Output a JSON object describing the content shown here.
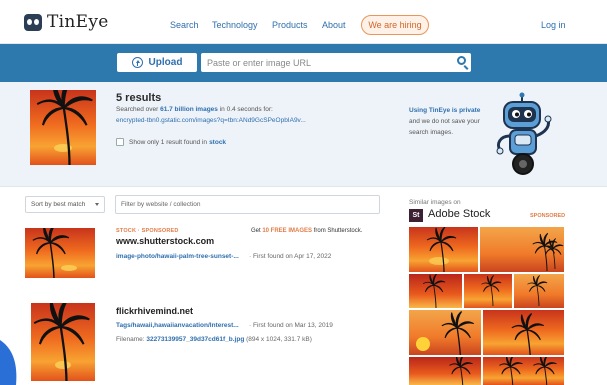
{
  "header": {
    "logo_text": "TinEye",
    "nav": [
      "Search",
      "Technology",
      "Products",
      "About"
    ],
    "hiring": "We are hiring",
    "login": "Log in"
  },
  "searchbar": {
    "upload_label": "Upload",
    "url_placeholder": "Paste or enter image URL"
  },
  "summary": {
    "results_count": "5 results",
    "searched_prefix": "Searched over ",
    "searched_count": "61.7 billion images",
    "searched_suffix": " in 0.4 seconds for:",
    "query_url": "encrypted-tbn0.gstatic.com/images?q=tbn:ANd9GcSPeOpbIA9v...",
    "show_one_prefix": "Show only 1 result found in",
    "show_one_link": "stock",
    "private_link": "Using TinEye is private",
    "private_text": "and we do not save your search images."
  },
  "toolbar": {
    "sort_label": "Sort by best match",
    "filter_placeholder": "Filter by website / collection"
  },
  "results": [
    {
      "sponsored": "STOCK · SPONSORED",
      "domain": "www.shutterstock.com",
      "path": "image-photo/hawaii-palm-tree-sunset-...",
      "found": "· First found on Apr 17, 2022"
    },
    {
      "domain": "flickrhivemind.net",
      "path": "Tags/hawaii,hawaiianvacation/Interest...",
      "found": "· First found on Mar 13, 2019",
      "file_label": "Filename:",
      "file_name": "32273139957_39d37cd61f_b.jpg",
      "file_meta": " (894 x 1024, 331.7 kB)"
    }
  ],
  "promo": {
    "prefix": "Get ",
    "highlight": "10 FREE IMAGES",
    "suffix": " from Shutterstock."
  },
  "similar": {
    "label": "Similar images on",
    "brand_mark": "St",
    "brand": "Adobe Stock",
    "sponsored": "SPONSORED"
  },
  "colors": {
    "brand_blue": "#2d79ad",
    "link_blue": "#2f6fae",
    "sponsored_orange": "#e37b45",
    "summary_bg": "#eef3f9"
  }
}
